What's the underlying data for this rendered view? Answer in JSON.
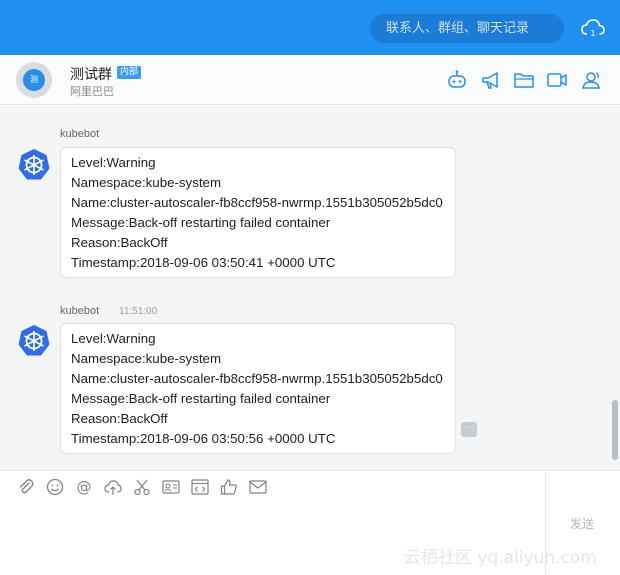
{
  "search": {
    "placeholder": "联系人、群组、聊天记录"
  },
  "chat": {
    "group_name": "测试群",
    "badge": "内部",
    "org": "阿里巴巴",
    "avatar_text": "测"
  },
  "messages": [
    {
      "sender": "kubebot",
      "time": "",
      "lines": [
        "Level:Warning",
        "Namespace:kube-system",
        "Name:cluster-autoscaler-fb8ccf958-nwrmp.1551b305052b5dc0",
        "Message:Back-off restarting failed container",
        "Reason:BackOff",
        "Timestamp:2018-09-06 03:50:41 +0000 UTC"
      ]
    },
    {
      "sender": "kubebot",
      "time": "11:51:00",
      "lines": [
        "Level:Warning",
        "Namespace:kube-system",
        "Name:cluster-autoscaler-fb8ccf958-nwrmp.1551b305052b5dc0",
        "Message:Back-off restarting failed container",
        "Reason:BackOff",
        "Timestamp:2018-09-06 03:50:56 +0000 UTC"
      ]
    }
  ],
  "input": {
    "send_label": "发送"
  },
  "watermark": "云栖社区 yq.aliyun.com",
  "icons": {
    "header": [
      "robot-icon",
      "megaphone-icon",
      "folder-icon",
      "video-icon",
      "contacts-icon"
    ],
    "toolbar": [
      "attachment-icon",
      "emoji-icon",
      "mention-icon",
      "cloud-upload-icon",
      "scissors-icon",
      "contact-card-icon",
      "code-icon",
      "thumbs-up-icon",
      "mail-icon"
    ]
  },
  "colors": {
    "brand": "#1f8ff0",
    "kube": "#326ce5"
  }
}
